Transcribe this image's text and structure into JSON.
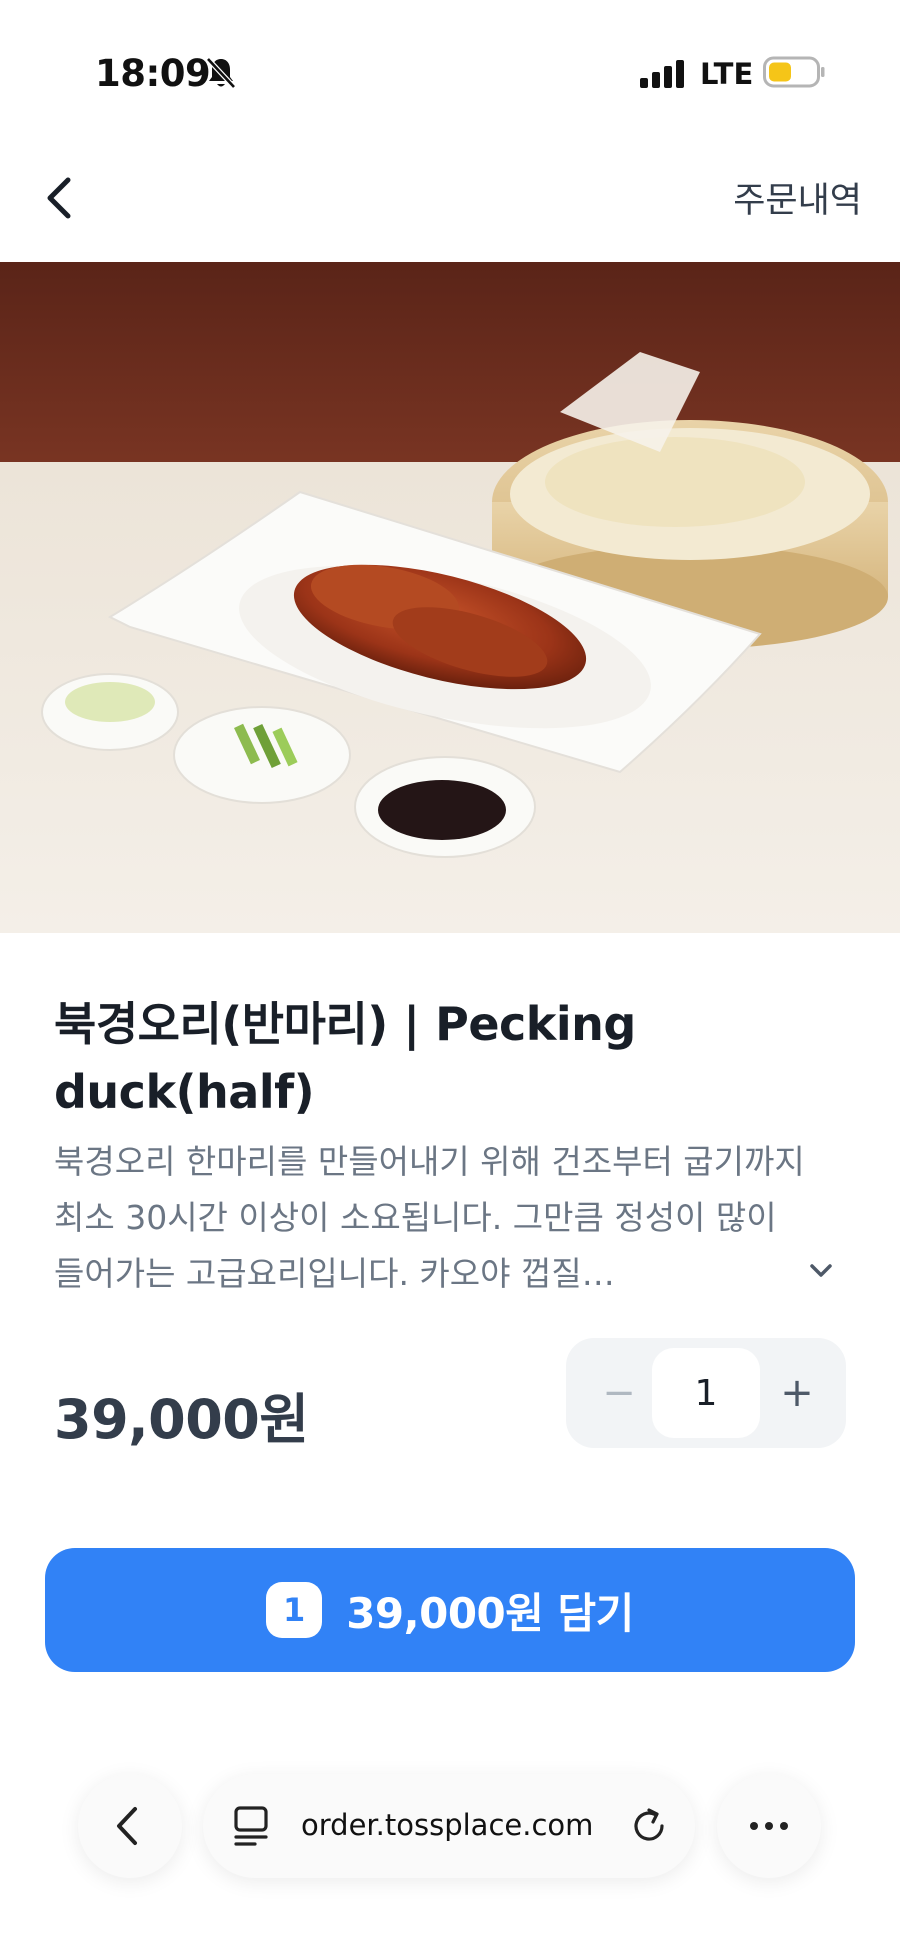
{
  "status_bar": {
    "time": "18:09",
    "network": "LTE",
    "icons": [
      "bell-slash-icon",
      "signal-icon",
      "battery-icon"
    ],
    "battery_color": "#f5c518"
  },
  "nav": {
    "back_icon": "chevron-left-icon",
    "order_history_label": "주문내역"
  },
  "hero": {
    "image_subject": "peking-duck-plate-image"
  },
  "product": {
    "title": "북경오리(반마리) | Pecking duck(half)",
    "description": "북경오리 한마리를 만들어내기 위해 건조부터 굽기까지 최소 30시간 이상이 소요됩니다. 그만큼 정성이 많이 들어가는 고급요리입니다. 카오야 껍질…",
    "price": "39,000원"
  },
  "stepper": {
    "minus": "−",
    "value": "1",
    "plus": "+"
  },
  "add_button": {
    "count": "1",
    "label": "39,000원 담기",
    "color": "#3182f6"
  },
  "browser": {
    "url": "order.tossplace.com",
    "icons": [
      "chevron-left-icon",
      "tabs-icon",
      "reload-icon",
      "more-icon"
    ]
  }
}
